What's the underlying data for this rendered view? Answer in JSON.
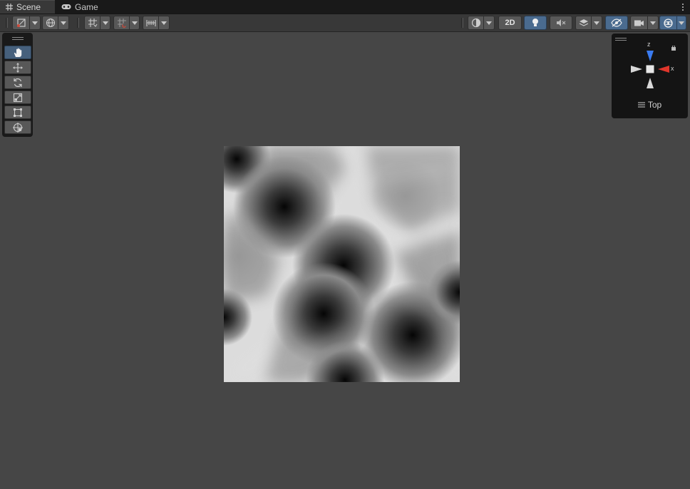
{
  "tabs": [
    {
      "label": "Scene",
      "icon": "grid-icon",
      "active": true
    },
    {
      "label": "Game",
      "icon": "gamepad-icon",
      "active": false
    }
  ],
  "toolbar": {
    "view_2d_label": "2D",
    "icons": [
      "draw-mode-icon",
      "globe-icon",
      "grid-snap-icon",
      "increment-snap-icon",
      "ruler-snap-icon",
      "shading-mode-icon",
      "lighting-icon",
      "audio-mute-icon",
      "effects-icon",
      "visibility-icon",
      "camera-icon",
      "gizmos-icon"
    ]
  },
  "tools": [
    "hand-tool",
    "move-tool",
    "rotate-tool",
    "scale-tool",
    "rect-tool",
    "transform-tool"
  ],
  "gizmo": {
    "view_label": "Top",
    "axis_z": "z",
    "axis_x": "x",
    "colors": {
      "z": "#3a7bf0",
      "x": "#e0362b",
      "neutral": "#d8d8d8"
    }
  },
  "texture": {
    "description_type": "voronoi-noise-texture",
    "colors": {
      "dark": "#050505",
      "light": "#f2f2f2"
    }
  }
}
